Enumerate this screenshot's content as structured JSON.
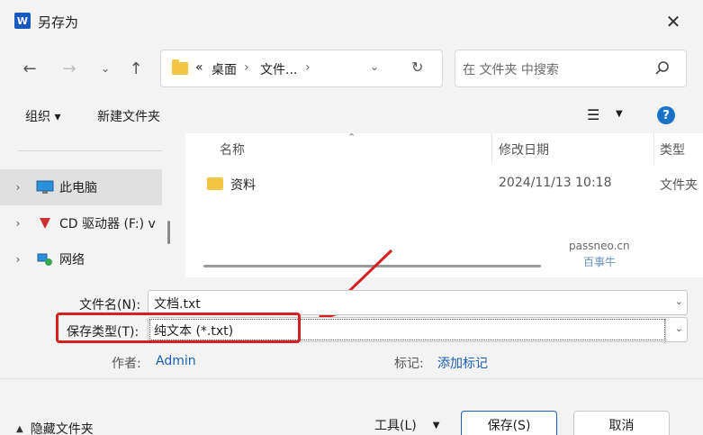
{
  "window": {
    "title": "另存为",
    "app_icon": "W"
  },
  "nav": {
    "address_prefix": "«",
    "crumbs": [
      "桌面",
      "文件..."
    ],
    "search_placeholder": "在 文件夹 中搜索"
  },
  "toolbar": {
    "organize": "组织 ▾",
    "new_folder": "新建文件夹"
  },
  "sidebar": {
    "items": [
      {
        "label": "此电脑"
      },
      {
        "label": "CD 驱动器 (F:) v"
      },
      {
        "label": "网络"
      }
    ]
  },
  "file_list": {
    "columns": [
      "名称",
      "修改日期",
      "类型"
    ],
    "rows": [
      {
        "name": "资料",
        "date": "2024/11/13 10:18",
        "type": "文件夹"
      }
    ],
    "watermark_1": "passneo.cn",
    "watermark_2": "百事牛"
  },
  "form": {
    "filename_label": "文件名(N):",
    "filename_value": "文档.txt",
    "filetype_label": "保存类型(T):",
    "filetype_value": "纯文本 (*.txt)",
    "author_label": "作者:",
    "author_value": "Admin",
    "tags_label": "标记:",
    "tags_value": "添加标记"
  },
  "footer": {
    "hide_folders": "隐藏文件夹",
    "tools": "工具(L)",
    "save": "保存(S)",
    "cancel": "取消"
  },
  "colors": {
    "accent": "#1a73c8",
    "highlight_red": "#d42020",
    "folder": "#f4c542"
  }
}
